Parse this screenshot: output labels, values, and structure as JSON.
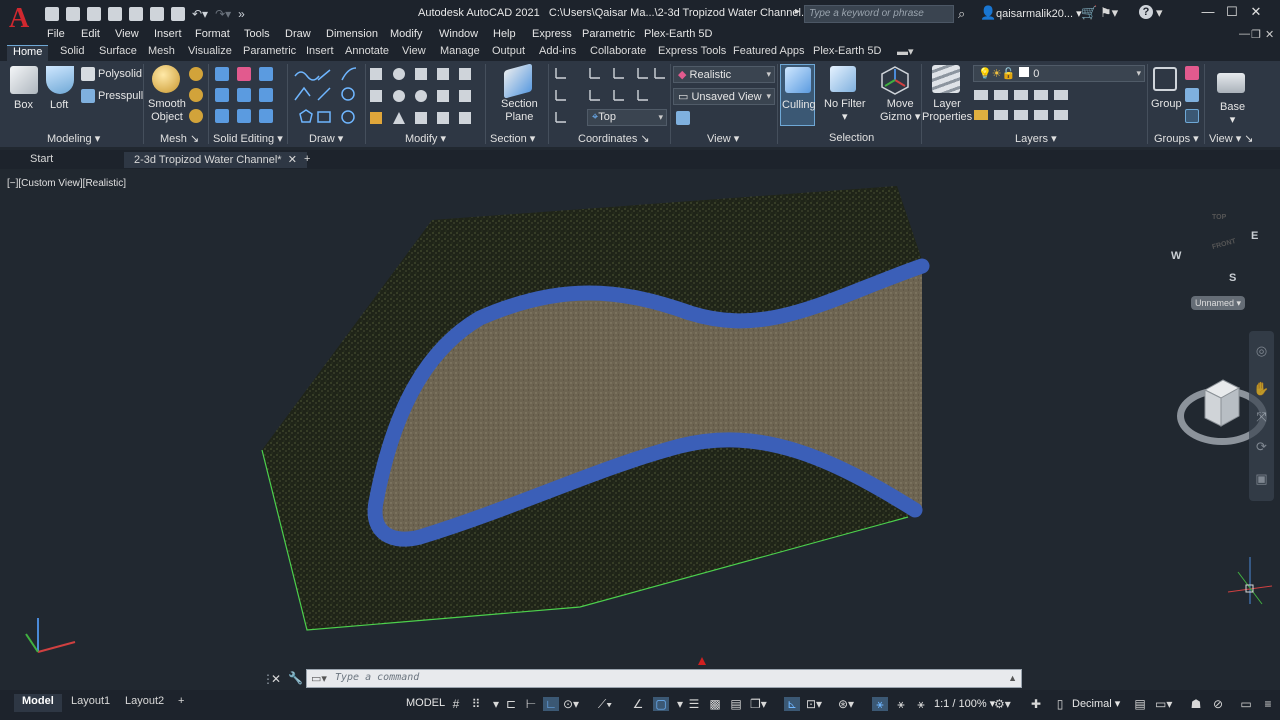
{
  "titlebar": {
    "app_title": "Autodesk AutoCAD 2021",
    "file_path": "C:\\Users\\Qaisar Ma...\\2-3d Tropizod Water Channel.dwg",
    "search_placeholder": "Type a keyword or phrase",
    "user": "qaisarmalik20...",
    "help_icon": "?"
  },
  "menu": [
    "File",
    "Edit",
    "View",
    "Insert",
    "Format",
    "Tools",
    "Draw",
    "Dimension",
    "Modify",
    "Window",
    "Help",
    "Express",
    "Parametric",
    "Plex-Earth 5D"
  ],
  "ribbon_tabs": [
    "Home",
    "Solid",
    "Surface",
    "Mesh",
    "Visualize",
    "Parametric",
    "Insert",
    "Annotate",
    "View",
    "Manage",
    "Output",
    "Add-ins",
    "Collaborate",
    "Express Tools",
    "Featured Apps",
    "Plex-Earth 5D"
  ],
  "ribbon": {
    "modeling": {
      "title": "Modeling",
      "box": "Box",
      "loft": "Loft",
      "polysolid": "Polysolid",
      "presspull": "Presspull"
    },
    "mesh": {
      "title": "Mesh",
      "smooth_line1": "Smooth",
      "smooth_line2": "Object"
    },
    "solid_editing": {
      "title": "Solid Editing"
    },
    "draw": {
      "title": "Draw"
    },
    "modify": {
      "title": "Modify"
    },
    "section": {
      "title": "Section",
      "plane_line1": "Section",
      "plane_line2": "Plane"
    },
    "coordinates": {
      "title": "Coordinates",
      "ucs_dropdown": "Top"
    },
    "view": {
      "title": "View",
      "visual_style": "Realistic",
      "saved_view": "Unsaved View"
    },
    "selection": {
      "title": "Selection",
      "culling": "Culling",
      "no_filter": "No Filter",
      "gizmo_line1": "Move",
      "gizmo_line2": "Gizmo"
    },
    "layers": {
      "title": "Layers",
      "properties_line1": "Layer",
      "properties_line2": "Properties",
      "current_layer": "0"
    },
    "groups": {
      "title": "Groups",
      "group": "Group"
    },
    "view2": {
      "title": "View",
      "base": "Base"
    }
  },
  "file_tabs": [
    "Start",
    "2-3d Tropizod Water Channel*"
  ],
  "viewport": {
    "label": "[−][Custom View][Realistic]",
    "viewcube": {
      "top": "TOP",
      "front": "FRONT",
      "n": "W",
      "e": "E",
      "s": "S",
      "ucs_name": "Unnamed"
    }
  },
  "command": {
    "placeholder": "Type a command"
  },
  "layout_tabs": [
    "Model",
    "Layout1",
    "Layout2"
  ],
  "status": {
    "model": "MODEL",
    "scale": "1:1 / 100%",
    "units": "Decimal"
  },
  "colors": {
    "water": "#3b5fb8",
    "terrain": "#1f2418",
    "channel_bed": "#6d6451",
    "edge": "#4cd04c",
    "accent": "#6fa8d6"
  }
}
